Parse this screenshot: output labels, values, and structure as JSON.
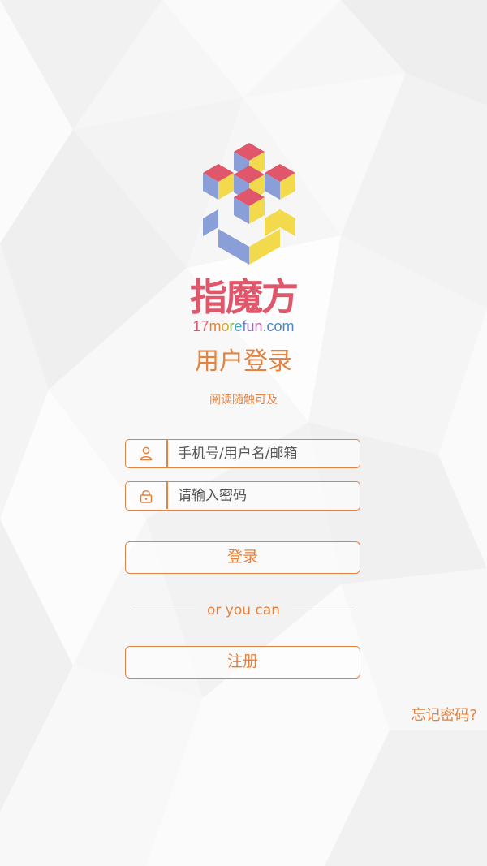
{
  "brand": {
    "name": "指魔方",
    "url_parts": [
      {
        "text": "17",
        "color": "#e0566b"
      },
      {
        "text": "m",
        "color": "#e5823f"
      },
      {
        "text": "o",
        "color": "#d6a83a"
      },
      {
        "text": "r",
        "color": "#7bb35a"
      },
      {
        "text": "e",
        "color": "#4aa7c7"
      },
      {
        "text": "f",
        "color": "#6a7fc9"
      },
      {
        "text": "u",
        "color": "#9b6ac9"
      },
      {
        "text": "n",
        "color": "#c85aa8"
      },
      {
        "text": ".com",
        "color": "#4a86c8"
      }
    ]
  },
  "login": {
    "title": "用户登录",
    "subtitle": "阅读随触可及",
    "username_placeholder": "手机号/用户名/邮箱",
    "password_placeholder": "请输入密码",
    "login_label": "登录",
    "divider_text": "or you can",
    "register_label": "注册",
    "forgot_label": "忘记密码?"
  },
  "colors": {
    "accent": "#e5823f",
    "cube_red": "#e0566b",
    "cube_yellow": "#f3d94c",
    "cube_blue": "#8a9fd8"
  },
  "icons": {
    "username": "user-icon",
    "password": "lock-icon"
  }
}
